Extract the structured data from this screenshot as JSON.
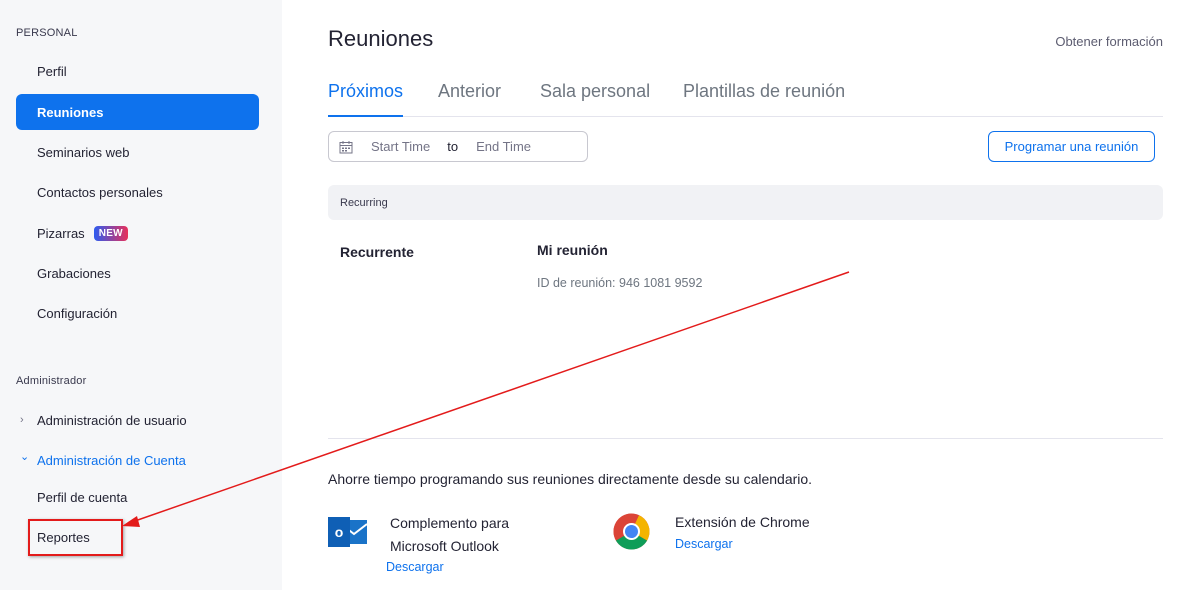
{
  "sidebar": {
    "personal_label": "PERSONAL",
    "items": [
      {
        "label": "Perfil"
      },
      {
        "label": "Reuniones"
      },
      {
        "label": "Seminarios web"
      },
      {
        "label": "Contactos personales"
      },
      {
        "label": "Pizarras",
        "badge": "NEW"
      },
      {
        "label": "Grabaciones"
      },
      {
        "label": "Configuración"
      }
    ],
    "admin_label": "Administrador",
    "admin_items": [
      {
        "label": "Administración de usuario",
        "chevron": "›"
      },
      {
        "label": "Administración de Cuenta",
        "chevron": "⌄"
      },
      {
        "label": "Perfil de cuenta"
      },
      {
        "label": "Reportes"
      }
    ]
  },
  "header": {
    "title": "Reuniones",
    "training_link": "Obtener formación"
  },
  "tabs": [
    {
      "label": "Próximos",
      "active": true
    },
    {
      "label": "Anterior"
    },
    {
      "label": "Sala personal"
    },
    {
      "label": "Plantillas de reunión"
    }
  ],
  "filter": {
    "icon": "calendar-icon",
    "start": "Start Time",
    "to": "to",
    "end": "End Time"
  },
  "schedule_button": "Programar una reunión",
  "group": {
    "header": "Recurring",
    "meeting": {
      "type": "Recurrente",
      "title": "Mi reunión",
      "id_text": "ID de reunión: 946 1081 9592"
    }
  },
  "promo": {
    "text": "Ahorre tiempo programando sus reuniones directamente desde su calendario.",
    "outlook": {
      "title": "Complemento para Microsoft Outlook",
      "link": "Descargar",
      "icon": "outlook-icon"
    },
    "chrome": {
      "title": "Extensión de Chrome",
      "link": "Descargar",
      "icon": "chrome-icon"
    }
  },
  "colors": {
    "accent": "#0e72ed",
    "annotation": "#e31b1b",
    "sidebar_bg": "#f6f7f9"
  }
}
